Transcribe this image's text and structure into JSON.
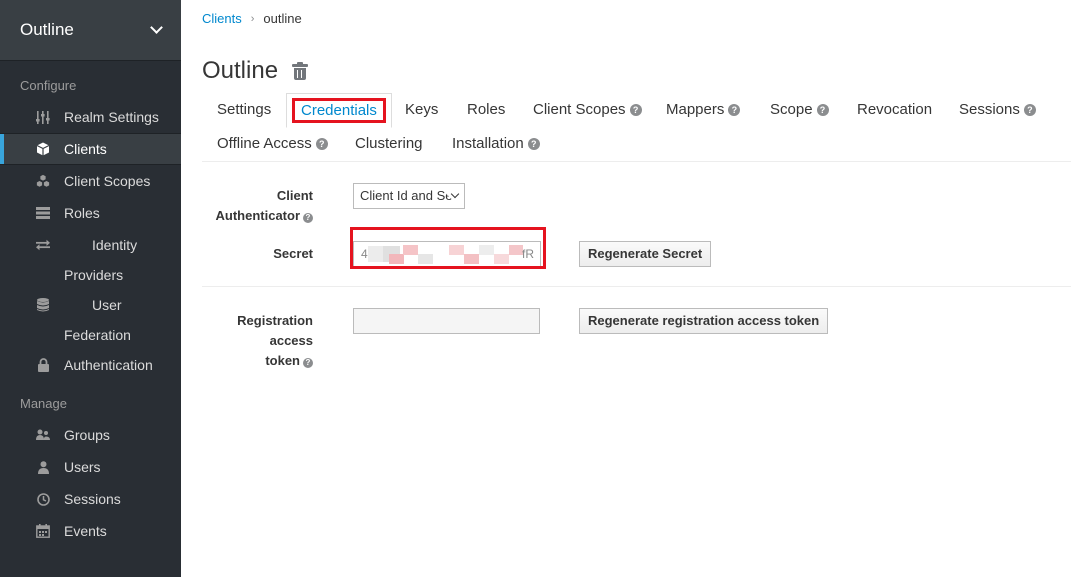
{
  "sidebar": {
    "realm": "Outline",
    "configure_label": "Configure",
    "manage_label": "Manage",
    "configure_items": [
      {
        "label": "Realm Settings",
        "icon": "sliders-icon"
      },
      {
        "label": "Clients",
        "icon": "cube-icon"
      },
      {
        "label": "Client Scopes",
        "icon": "cubes-icon"
      },
      {
        "label": "Roles",
        "icon": "list-icon"
      },
      {
        "label": "Identity Providers",
        "icon": "exchange-icon"
      },
      {
        "label": "User Federation",
        "icon": "database-icon"
      },
      {
        "label": "Authentication",
        "icon": "lock-icon"
      }
    ],
    "manage_items": [
      {
        "label": "Groups",
        "icon": "users-icon"
      },
      {
        "label": "Users",
        "icon": "user-icon"
      },
      {
        "label": "Sessions",
        "icon": "clock-icon"
      },
      {
        "label": "Events",
        "icon": "calendar-icon"
      }
    ]
  },
  "breadcrumb": {
    "link": "Clients",
    "current": "outline"
  },
  "page_title": "Outline",
  "tabs": [
    {
      "label": "Settings"
    },
    {
      "label": "Credentials"
    },
    {
      "label": "Keys"
    },
    {
      "label": "Roles"
    },
    {
      "label": "Client Scopes"
    },
    {
      "label": "Mappers"
    },
    {
      "label": "Scope"
    },
    {
      "label": "Revocation"
    },
    {
      "label": "Sessions"
    },
    {
      "label": "Offline Access"
    },
    {
      "label": "Clustering"
    },
    {
      "label": "Installation"
    }
  ],
  "form": {
    "client_auth_label_1": "Client",
    "client_auth_label_2": "Authenticator",
    "client_auth_value": "Client Id and Se",
    "secret_label": "Secret",
    "secret_value_start": "4",
    "secret_value_end": "fR",
    "regen_secret": "Regenerate Secret",
    "reg_token_label_1": "Registration access",
    "reg_token_label_2": "token",
    "regen_token": "Regenerate registration access token"
  },
  "colors": {
    "accent": "#0088ce",
    "highlight": "#e5131f",
    "sidebar": "#292e34"
  }
}
